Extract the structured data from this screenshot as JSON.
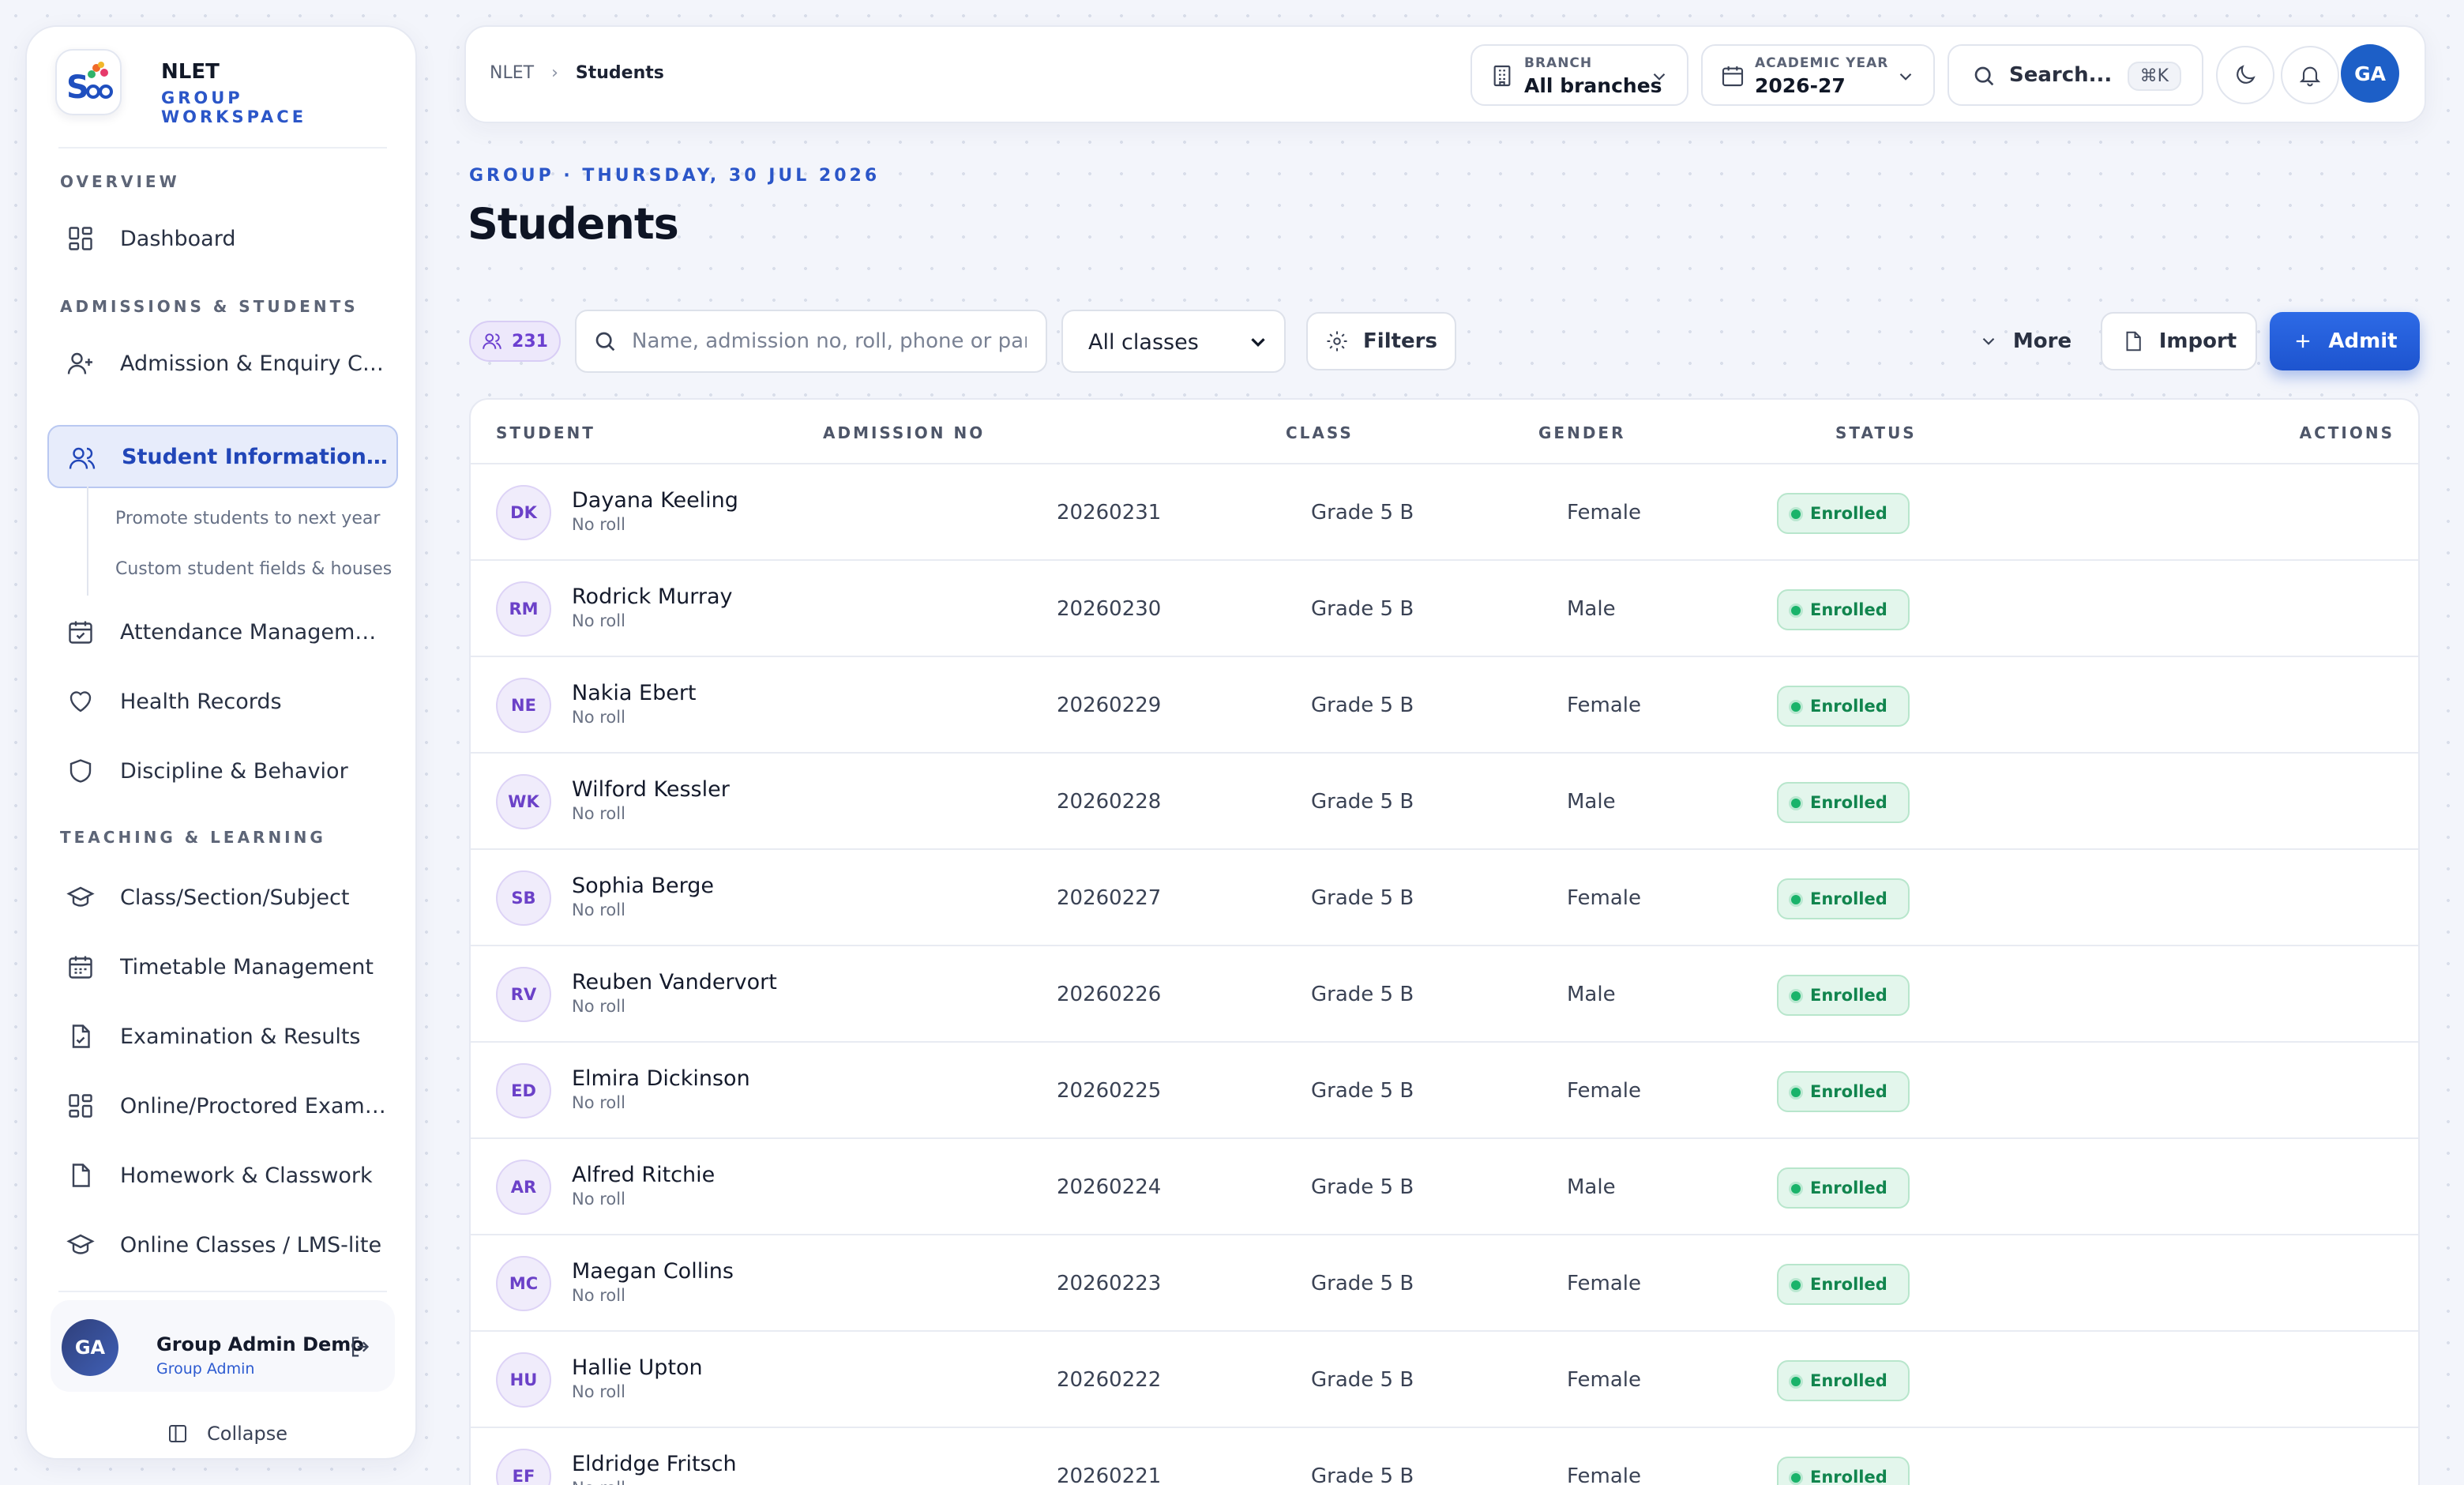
{
  "sidebar": {
    "brand_name": "NLET",
    "brand_sub": "GROUP WORKSPACE",
    "sections": {
      "overview": "OVERVIEW",
      "admissions": "ADMISSIONS & STUDENTS",
      "teaching": "TEACHING & LEARNING"
    },
    "items": {
      "dashboard": "Dashboard",
      "admission_crm": "Admission & Enquiry CRM",
      "sis": "Student Information Sys...",
      "promote": "Promote students to next year",
      "custom_fields": "Custom student fields & houses",
      "attendance": "Attendance Management",
      "health": "Health Records",
      "discipline": "Discipline & Behavior",
      "class_section": "Class/Section/Subject",
      "timetable": "Timetable Management",
      "exams": "Examination & Results",
      "online_exam": "Online/Proctored Exam (...",
      "homework": "Homework & Classwork",
      "lms": "Online Classes / LMS-lite"
    },
    "user": {
      "initials": "GA",
      "name": "Group Admin Demo",
      "role": "Group Admin"
    },
    "collapse_label": "Collapse"
  },
  "topbar": {
    "breadcrumb_root": "NLET",
    "breadcrumb_current": "Students",
    "branch_label": "BRANCH",
    "branch_value": "All branches",
    "year_label": "ACADEMIC YEAR",
    "year_value": "2026-27",
    "search_label": "Search...",
    "search_shortcut": "⌘K",
    "avatar_initials": "GA"
  },
  "header": {
    "eyebrow": "GROUP · THURSDAY, 30 JUL 2026",
    "title": "Students"
  },
  "toolbar": {
    "count": "231",
    "search_placeholder": "Name, admission no, roll, phone or parent",
    "class_filter": "All classes",
    "filters_label": "Filters",
    "more_label": "More",
    "import_label": "Import",
    "admit_label": "Admit"
  },
  "table": {
    "headers": {
      "student": "STUDENT",
      "admission_no": "ADMISSION NO",
      "class": "CLASS",
      "gender": "GENDER",
      "status": "STATUS",
      "actions": "ACTIONS"
    },
    "rows": [
      {
        "initials": "DK",
        "name": "Dayana Keeling",
        "roll": "No roll",
        "admission_no": "20260231",
        "class": "Grade 5 B",
        "gender": "Female",
        "status": "Enrolled"
      },
      {
        "initials": "RM",
        "name": "Rodrick Murray",
        "roll": "No roll",
        "admission_no": "20260230",
        "class": "Grade 5 B",
        "gender": "Male",
        "status": "Enrolled"
      },
      {
        "initials": "NE",
        "name": "Nakia Ebert",
        "roll": "No roll",
        "admission_no": "20260229",
        "class": "Grade 5 B",
        "gender": "Female",
        "status": "Enrolled"
      },
      {
        "initials": "WK",
        "name": "Wilford Kessler",
        "roll": "No roll",
        "admission_no": "20260228",
        "class": "Grade 5 B",
        "gender": "Male",
        "status": "Enrolled"
      },
      {
        "initials": "SB",
        "name": "Sophia Berge",
        "roll": "No roll",
        "admission_no": "20260227",
        "class": "Grade 5 B",
        "gender": "Female",
        "status": "Enrolled"
      },
      {
        "initials": "RV",
        "name": "Reuben Vandervort",
        "roll": "No roll",
        "admission_no": "20260226",
        "class": "Grade 5 B",
        "gender": "Male",
        "status": "Enrolled"
      },
      {
        "initials": "ED",
        "name": "Elmira Dickinson",
        "roll": "No roll",
        "admission_no": "20260225",
        "class": "Grade 5 B",
        "gender": "Female",
        "status": "Enrolled"
      },
      {
        "initials": "AR",
        "name": "Alfred Ritchie",
        "roll": "No roll",
        "admission_no": "20260224",
        "class": "Grade 5 B",
        "gender": "Male",
        "status": "Enrolled"
      },
      {
        "initials": "MC",
        "name": "Maegan Collins",
        "roll": "No roll",
        "admission_no": "20260223",
        "class": "Grade 5 B",
        "gender": "Female",
        "status": "Enrolled"
      },
      {
        "initials": "HU",
        "name": "Hallie Upton",
        "roll": "No roll",
        "admission_no": "20260222",
        "class": "Grade 5 B",
        "gender": "Female",
        "status": "Enrolled"
      },
      {
        "initials": "EF",
        "name": "Eldridge Fritsch",
        "roll": "No roll",
        "admission_no": "20260221",
        "class": "Grade 5 B",
        "gender": "Female",
        "status": "Enrolled"
      }
    ]
  }
}
